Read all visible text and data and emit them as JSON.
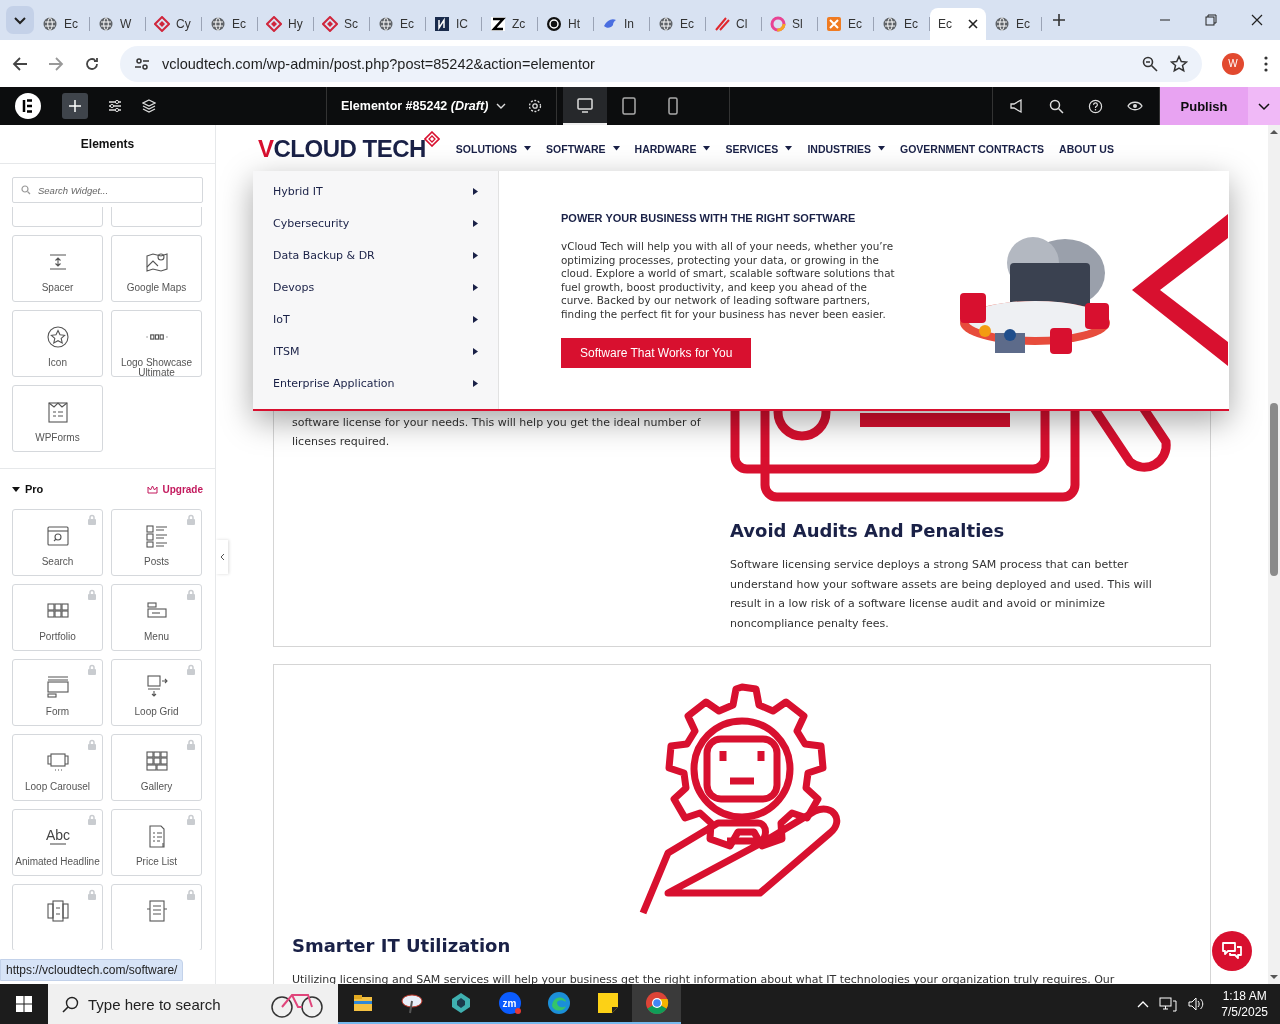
{
  "browser": {
    "tabs": [
      {
        "label": "Ec",
        "kind": "globe",
        "selected": false
      },
      {
        "label": "W",
        "kind": "globe",
        "selected": false
      },
      {
        "label": "Cy",
        "kind": "diamond",
        "selected": false
      },
      {
        "label": "Ec",
        "kind": "globe",
        "selected": false
      },
      {
        "label": "Hy",
        "kind": "diamond",
        "selected": false
      },
      {
        "label": "Sc",
        "kind": "diamond",
        "selected": false
      },
      {
        "label": "Ec",
        "kind": "globe",
        "selected": false
      },
      {
        "label": "IC",
        "kind": "square",
        "selected": false
      },
      {
        "label": "Zc",
        "kind": "zed",
        "selected": false
      },
      {
        "label": "Ht",
        "kind": "knot",
        "selected": false
      },
      {
        "label": "In",
        "kind": "bird",
        "selected": false
      },
      {
        "label": "Ec",
        "kind": "globe",
        "selected": false
      },
      {
        "label": "Cl",
        "kind": "swoosh",
        "selected": false
      },
      {
        "label": "Sl",
        "kind": "ring",
        "selected": false
      },
      {
        "label": "Ec",
        "kind": "box",
        "selected": false
      },
      {
        "label": "Ec",
        "kind": "globe",
        "selected": false
      },
      {
        "label": "Ec",
        "kind": "none",
        "selected": true
      },
      {
        "label": "Ec",
        "kind": "globe",
        "selected": false
      }
    ],
    "address": "vcloudtech.com/wp-admin/post.php?post=85242&action=elementor",
    "profile": "W"
  },
  "editor_bar": {
    "document_title": "Elementor #85242",
    "document_status": "(Draft)",
    "devices": [
      {
        "kind": "desktop",
        "selected": true
      },
      {
        "kind": "tablet",
        "selected": false
      },
      {
        "kind": "mobile",
        "selected": false
      }
    ],
    "publish": "Publish"
  },
  "panel": {
    "title": "Elements",
    "search": {
      "placeholder": "Search Widget..."
    },
    "widgets": [
      {
        "kind": "cut"
      },
      {
        "kind": "cut"
      },
      {
        "label": "Spacer",
        "kind": "spacer"
      },
      {
        "label": "Google Maps",
        "kind": "map"
      },
      {
        "label": "Icon",
        "kind": "star"
      },
      {
        "label": "Logo Showcase Ultimate",
        "kind": "logos"
      },
      {
        "label": "WPForms",
        "kind": "wpforms"
      }
    ],
    "pro": {
      "title": "Pro",
      "expanded": true,
      "upgrade": "Upgrade",
      "widgets": [
        {
          "label": "Search",
          "kind": "search",
          "locked": true
        },
        {
          "label": "Posts",
          "kind": "posts",
          "locked": true
        },
        {
          "label": "Portfolio",
          "kind": "portfolio",
          "locked": true
        },
        {
          "label": "Menu",
          "kind": "menu",
          "locked": true
        },
        {
          "label": "Form",
          "kind": "form",
          "locked": true
        },
        {
          "label": "Loop Grid",
          "kind": "loopgrid",
          "locked": true
        },
        {
          "label": "Loop Carousel",
          "kind": "carousel",
          "locked": true
        },
        {
          "label": "Gallery",
          "kind": "gallery",
          "locked": true
        },
        {
          "label": "Animated Headline",
          "kind": "headline",
          "icon_text": "Abc",
          "locked": true
        },
        {
          "label": "Price List",
          "kind": "pricelist",
          "locked": true
        },
        {
          "kind": "pricing",
          "locked": true
        },
        {
          "kind": "testimonial",
          "locked": true
        }
      ]
    }
  },
  "status_url": "https://vcloudtech.com/software/",
  "site": {
    "logo": [
      {
        "text": "V",
        "accent": true
      },
      {
        "text": "CLOUD TECH",
        "accent": false
      }
    ],
    "nav": [
      {
        "label": "SOLUTIONS",
        "has_submenu": true
      },
      {
        "label": "SOFTWARE",
        "has_submenu": true
      },
      {
        "label": "HARDWARE",
        "has_submenu": true
      },
      {
        "label": "SERVICES",
        "has_submenu": true
      },
      {
        "label": "INDUSTRIES",
        "has_submenu": true
      },
      {
        "label": "GOVERNMENT CONTRACTS",
        "has_submenu": false
      },
      {
        "label": "ABOUT US",
        "has_submenu": false
      }
    ],
    "mega_menu": {
      "items": [
        {
          "label": "Hybrid IT",
          "has_submenu": true
        },
        {
          "label": "Cybersecurity",
          "has_submenu": true
        },
        {
          "label": "Data Backup & DR",
          "has_submenu": true
        },
        {
          "label": "Devops",
          "has_submenu": true
        },
        {
          "label": "IoT",
          "has_submenu": true
        },
        {
          "label": "ITSM",
          "has_submenu": true
        },
        {
          "label": "Enterprise Application",
          "has_submenu": true
        }
      ],
      "heading": "POWER YOUR BUSINESS WITH THE RIGHT SOFTWARE",
      "text": "vCloud Tech will help you with all of your needs, whether you’re optimizing processes, protecting your data, or growing in the cloud. Explore a world of smart, scalable software solutions that fuel growth, boost productivity, and keep you ahead of the curve. Backed by our network of leading software partners, finding the perfect fit for your business has never been easier.",
      "button": "Software That Works for You"
    },
    "sections": [
      {
        "left_text": "software license for your needs. This will help you get the ideal number of licenses required.",
        "heading": "Avoid Audits And Penalties",
        "body": "Software licensing service deploys a strong SAM process that can better understand how your software assets are being deployed and used. This will result in a low risk of a software license audit and avoid or minimize noncompliance penalty fees."
      },
      {
        "heading": "Smarter IT Utilization",
        "body": "Utilizing licensing and SAM services will help your business get the right information about what IT technologies your organization truly requires. Our"
      }
    ]
  },
  "taskbar": {
    "search_placeholder": "Type here to search",
    "apps": [
      {
        "kind": "explorer",
        "selected": false
      },
      {
        "kind": "paint",
        "selected": false
      },
      {
        "kind": "gem",
        "selected": false
      },
      {
        "kind": "zoom",
        "label": "zm",
        "selected": false
      },
      {
        "kind": "edge",
        "selected": false
      },
      {
        "kind": "notes",
        "selected": false
      },
      {
        "kind": "chrome",
        "selected": true
      }
    ],
    "time": "1:18 AM",
    "date": "7/5/2025"
  }
}
